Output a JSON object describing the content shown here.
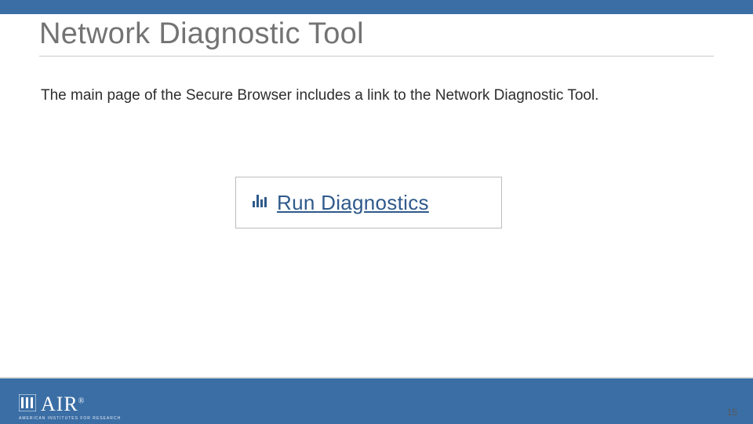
{
  "title": "Network Diagnostic Tool",
  "body": "The main page of the Secure Browser includes a link to the Network Diagnostic Tool.",
  "link": {
    "label": "Run Diagnostics",
    "icon": "bar-chart-icon"
  },
  "footer": {
    "logo_text": "AIR",
    "logo_sub": "AMERICAN INSTITUTES FOR RESEARCH",
    "reg": "®"
  },
  "page_number": "15",
  "colors": {
    "brand_blue": "#3a6ea5",
    "title_gray": "#737373",
    "link_blue": "#2f5a8b"
  }
}
